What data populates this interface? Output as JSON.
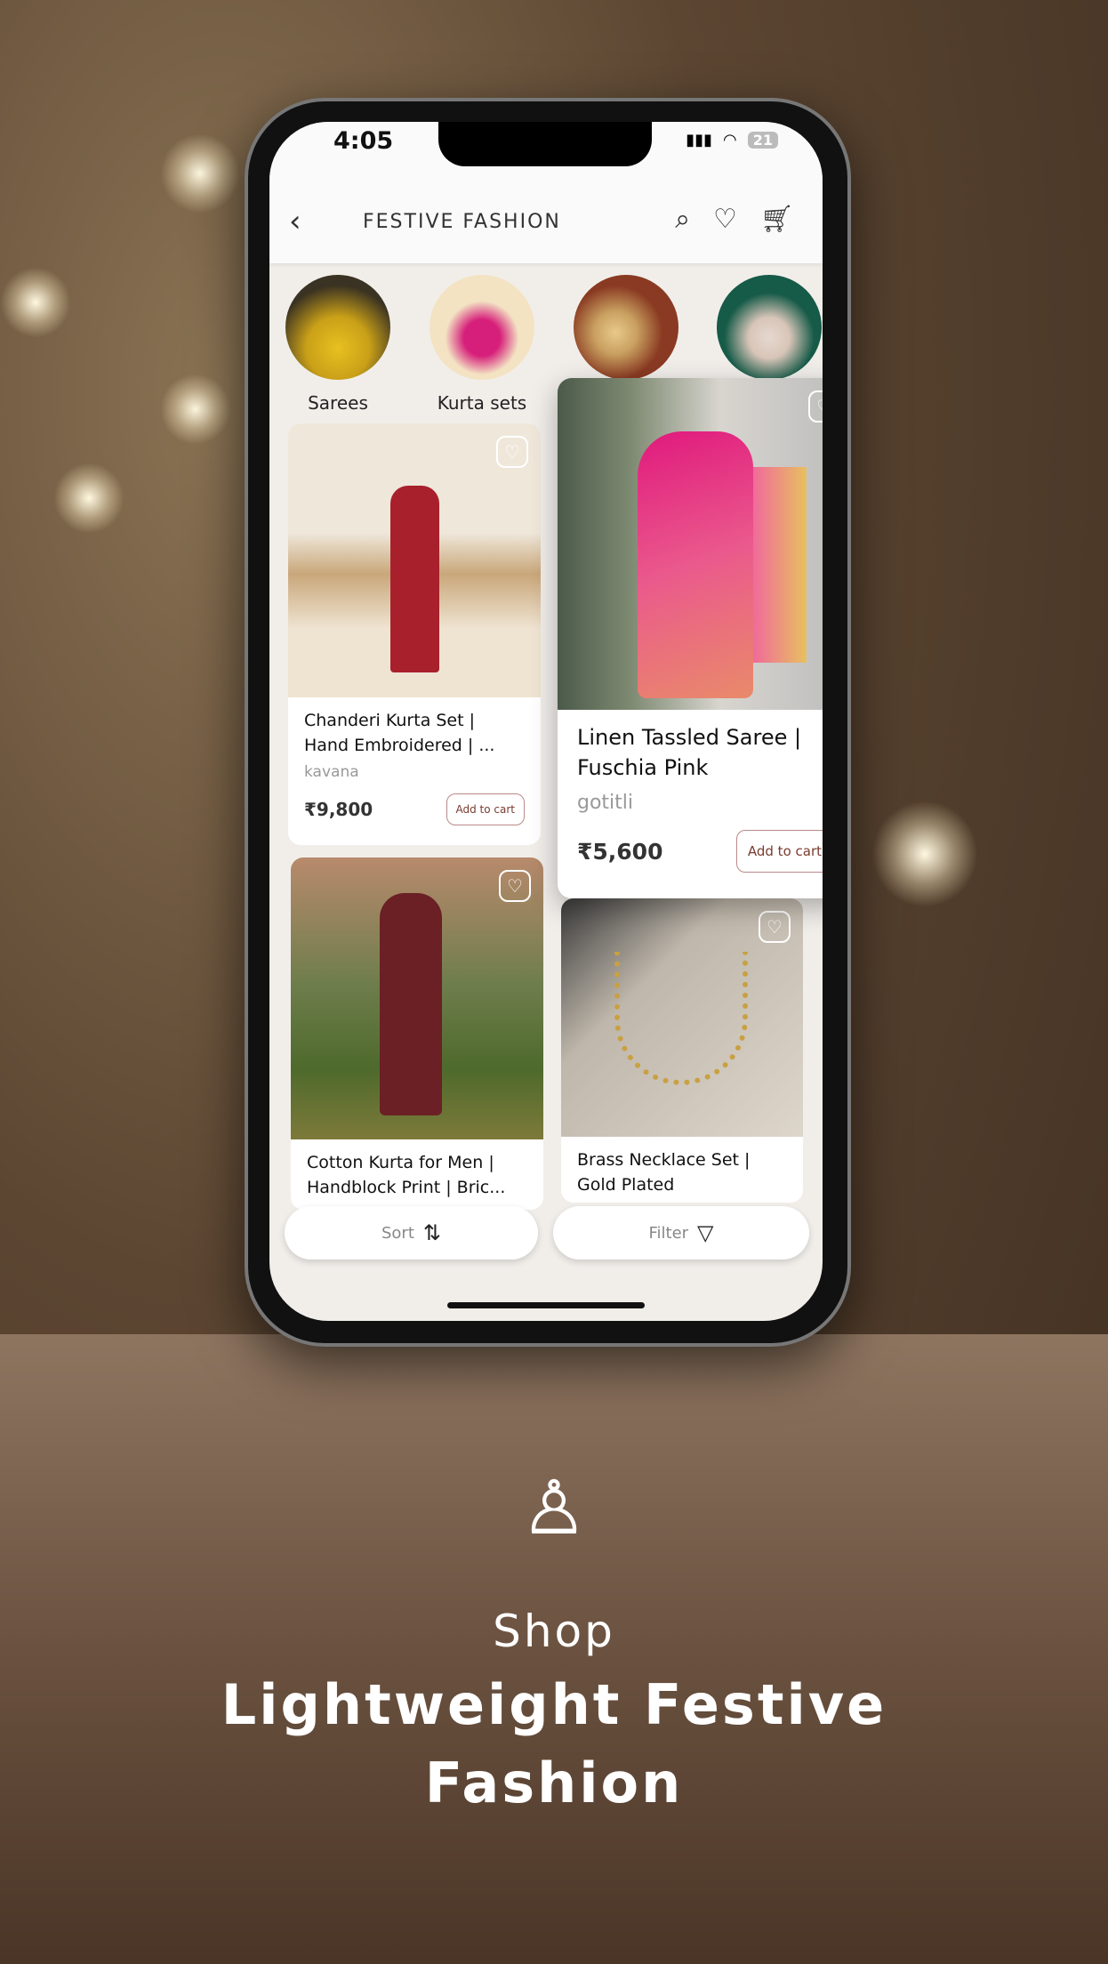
{
  "status_bar": {
    "time": "4:05",
    "battery": "21"
  },
  "header": {
    "title": "FESTIVE FASHION"
  },
  "categories": [
    {
      "label": "Sarees"
    },
    {
      "label": "Kurta sets"
    },
    {
      "label": ""
    },
    {
      "label": ""
    }
  ],
  "products": [
    {
      "name": "Chanderi Kurta Set | Hand Embroidered | ...",
      "brand": "kavana",
      "price": "₹9,800",
      "cta": "Add to cart"
    },
    {
      "name": "Linen Tassled Saree | Fuschia Pink",
      "brand": "gotitli",
      "price": "₹5,600",
      "cta": "Add to cart"
    },
    {
      "name": "Cotton Kurta for Men | Handblock Print | Bric...",
      "brand": "",
      "price": "",
      "cta": ""
    },
    {
      "name": "Brass Necklace Set | Gold Plated",
      "brand": "",
      "price": "",
      "cta": ""
    }
  ],
  "bottom_bar": {
    "sort": "Sort",
    "filter": "Filter"
  },
  "promo": {
    "line1": "Shop",
    "line2": "Lightweight Festive",
    "line3": "Fashion"
  },
  "colors": {
    "accent": "#7a3b2e"
  }
}
